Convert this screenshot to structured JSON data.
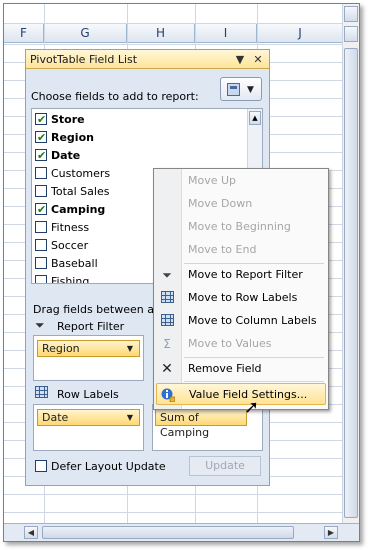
{
  "sheet": {
    "columns": [
      "F",
      "G",
      "H",
      "I",
      "J"
    ]
  },
  "panel": {
    "title": "PivotTable Field List",
    "dropdown_glyph": "▼",
    "close_glyph": "✕",
    "choose_label": "Choose fields to add to report:",
    "fields": [
      {
        "label": "Store",
        "checked": true
      },
      {
        "label": "Region",
        "checked": true
      },
      {
        "label": "Date",
        "checked": true
      },
      {
        "label": "Customers",
        "checked": false
      },
      {
        "label": "Total Sales",
        "checked": false
      },
      {
        "label": "Camping",
        "checked": true
      },
      {
        "label": "Fitness",
        "checked": false
      },
      {
        "label": "Soccer",
        "checked": false
      },
      {
        "label": "Baseball",
        "checked": false
      },
      {
        "label": "Fishing",
        "checked": false
      }
    ],
    "drag_label": "Drag fields between area",
    "report_filter_label": "Report Filter",
    "row_labels_label": "Row Labels",
    "report_filter_chip": "Region",
    "row_labels_chip": "Date",
    "values_chip": "Sum of Camping",
    "defer_label": "Defer Layout Update",
    "update_label": "Update"
  },
  "menu": {
    "items": [
      {
        "label": "Move Up",
        "enabled": false,
        "icon": ""
      },
      {
        "label": "Move Down",
        "enabled": false,
        "icon": ""
      },
      {
        "label": "Move to Beginning",
        "enabled": false,
        "icon": ""
      },
      {
        "label": "Move to End",
        "enabled": false,
        "icon": ""
      },
      {
        "label": "Move to Report Filter",
        "enabled": true,
        "icon": "filter-icon"
      },
      {
        "label": "Move to Row Labels",
        "enabled": true,
        "icon": "row-labels-icon"
      },
      {
        "label": "Move to Column Labels",
        "enabled": true,
        "icon": "column-labels-icon"
      },
      {
        "label": "Move to Values",
        "enabled": false,
        "icon": "sigma-icon"
      },
      {
        "label": "Remove Field",
        "enabled": true,
        "icon": "remove-x-icon"
      },
      {
        "label": "Value Field Settings...",
        "enabled": true,
        "icon": "info-settings-icon",
        "highlighted": true
      }
    ]
  }
}
